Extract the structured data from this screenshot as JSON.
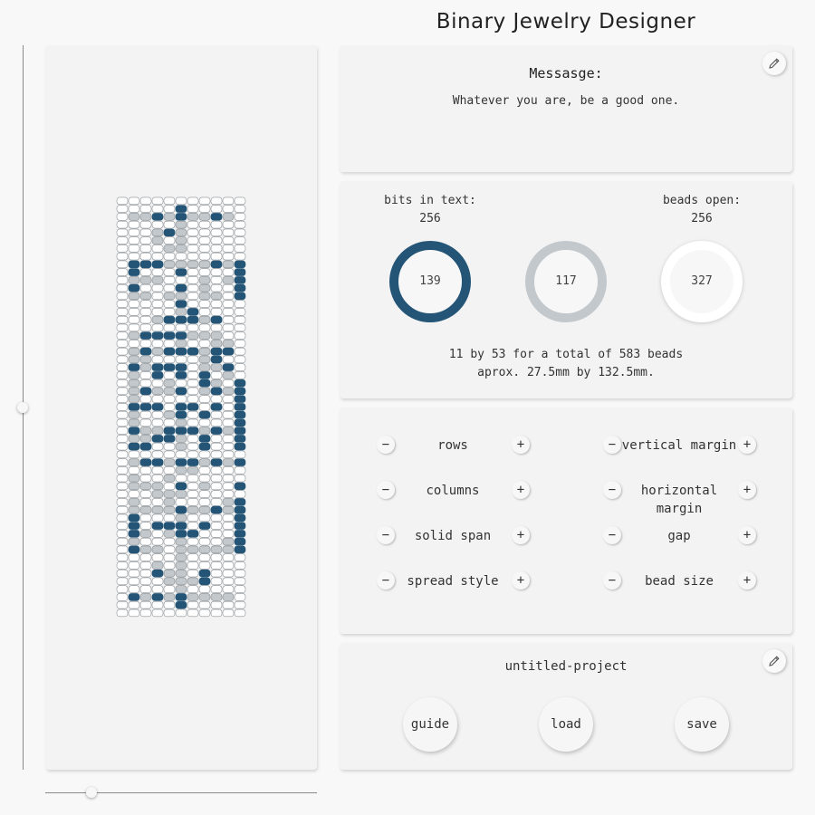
{
  "app": {
    "title": "Binary Jewelry Designer"
  },
  "pattern": {
    "columns": 11,
    "rows": 53,
    "colors": {
      "filled": "#245576",
      "light": "#c3c8cc",
      "empty": "#ffffff",
      "outline": "#8a9094"
    },
    "grid": [
      "00000000000",
      "00000200000",
      "01121211210",
      "00000100000",
      "00012100000",
      "00010100000",
      "00001100000",
      "00000000000",
      "02221111212",
      "02000200002",
      "01110001012",
      "02000201002",
      "01101101102",
      "00000200000",
      "00000120000",
      "00012221200",
      "00000000000",
      "01222211100",
      "00000100110",
      "01212221220",
      "01100001200",
      "02122201120",
      "01020202010",
      "01001002102",
      "01211201212",
      "01000000002",
      "02220220202",
      "01001202002",
      "01000100002",
      "02112221212",
      "01122102002",
      "02200102002",
      "00000000000",
      "01221221212",
      "00000110000",
      "01001000000",
      "01110201002",
      "00011100000",
      "01001000012",
      "01111211212",
      "02000100002",
      "02022202002",
      "02101220002",
      "01000100012",
      "02110111112",
      "00000100000",
      "00010100000",
      "00021102000",
      "00001112000",
      "00000100000",
      "02121211110",
      "00000200000",
      "00000000000"
    ]
  },
  "message": {
    "heading": "Messasge:",
    "text": "Whatever you are, be a good one.",
    "edit_icon": "pencil-icon"
  },
  "stats": {
    "bits_label": "bits in text:",
    "bits_value": "256",
    "beads_label": "beads open:",
    "beads_value": "256",
    "ring1": {
      "value": "139",
      "color": "#245576"
    },
    "ring2": {
      "value": "117",
      "color": "#c3c8cc"
    },
    "ring3": {
      "value": "327",
      "color": "#ffffff"
    },
    "summary_line1": "11 by 53 for a total of 583 beads",
    "summary_line2": "aprox. 27.5mm by 132.5mm."
  },
  "controls": {
    "minus": "−",
    "plus": "+",
    "left": [
      "rows",
      "columns",
      "solid span",
      "spread style"
    ],
    "right": [
      "vertical margin",
      "horizontal margin",
      "gap",
      "bead size"
    ]
  },
  "project": {
    "name": "untitled-project",
    "edit_icon": "pencil-icon",
    "guide_label": "guide",
    "load_label": "load",
    "save_label": "save"
  },
  "sliders": {
    "vertical_value": 0.5,
    "horizontal_value": 0.17
  }
}
